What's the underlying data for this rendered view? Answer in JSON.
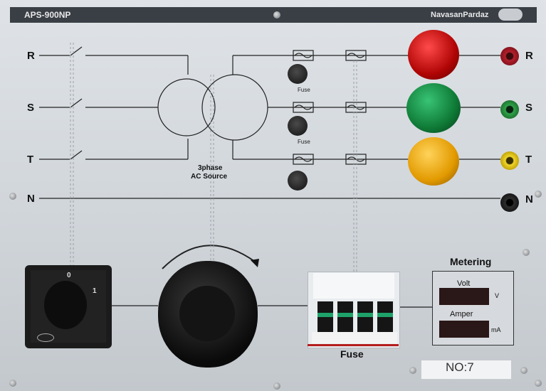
{
  "header": {
    "model": "APS-900NP",
    "brand": "NavasanPardaz"
  },
  "phases": {
    "left": [
      "R",
      "S",
      "T",
      "N"
    ],
    "right": [
      "R",
      "S",
      "T",
      "N"
    ]
  },
  "source": {
    "line1": "3phase",
    "line2": "AC Source"
  },
  "fuses": {
    "label": "Fuse",
    "items": [
      "Fuse",
      "Fuse"
    ]
  },
  "selector": {
    "pos0": "0",
    "pos1": "1"
  },
  "breaker": {
    "title": "Fuse"
  },
  "metering": {
    "title": "Metering",
    "volt_label": "Volt",
    "volt_unit": "V",
    "amp_label": "Amper",
    "amp_unit": "mA"
  },
  "plate": {
    "number": "NO:7"
  },
  "lamps": {
    "r_color": "#c41212",
    "s_color": "#138a43",
    "t_color": "#e8a400"
  }
}
